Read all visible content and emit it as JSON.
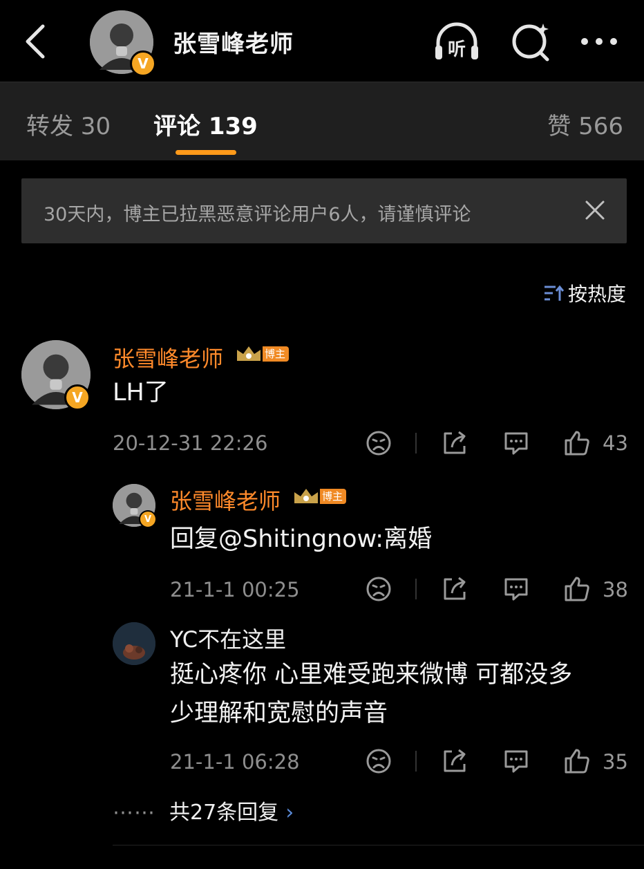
{
  "header": {
    "title": "张雪峰老师",
    "listen_label": "听",
    "back_icon": "chevron-left-icon",
    "search_icon": "search-icon",
    "more_icon": "more-icon",
    "avatar_badge": "V"
  },
  "tabs": {
    "repost": "转发 30",
    "comments": "评论 139",
    "likes": "赞 566"
  },
  "notice": {
    "text": "30天内，博主已拉黑恶意评论用户6人，请谨慎评论"
  },
  "sort": {
    "label": "按热度"
  },
  "colors": {
    "accent": "#ff9a1a",
    "username": "#ff8a2b",
    "background": "#000000",
    "tab_bg": "#1f1f1f",
    "link": "#5a8ad8"
  },
  "comments": [
    {
      "username": "张雪峰老师",
      "badge": "博主",
      "text": "LH了",
      "time": "20-12-31 22:26",
      "likes": "43",
      "avatar_badge": "V"
    },
    {
      "username": "张雪峰老师",
      "badge": "博主",
      "text": "回复@Shitingnow:离婚",
      "time": "21-1-1 00:25",
      "likes": "38",
      "avatar_badge": "V"
    },
    {
      "username": "YC不在这里",
      "text_line1": "挺心疼你 心里难受跑来微博 可都没多",
      "text_line2": "少理解和宽慰的声音",
      "time": "21-1-1 06:28",
      "likes": "35"
    }
  ],
  "replies": {
    "dots": "⋯⋯",
    "label": "共27条回复",
    "chevron": "›"
  }
}
